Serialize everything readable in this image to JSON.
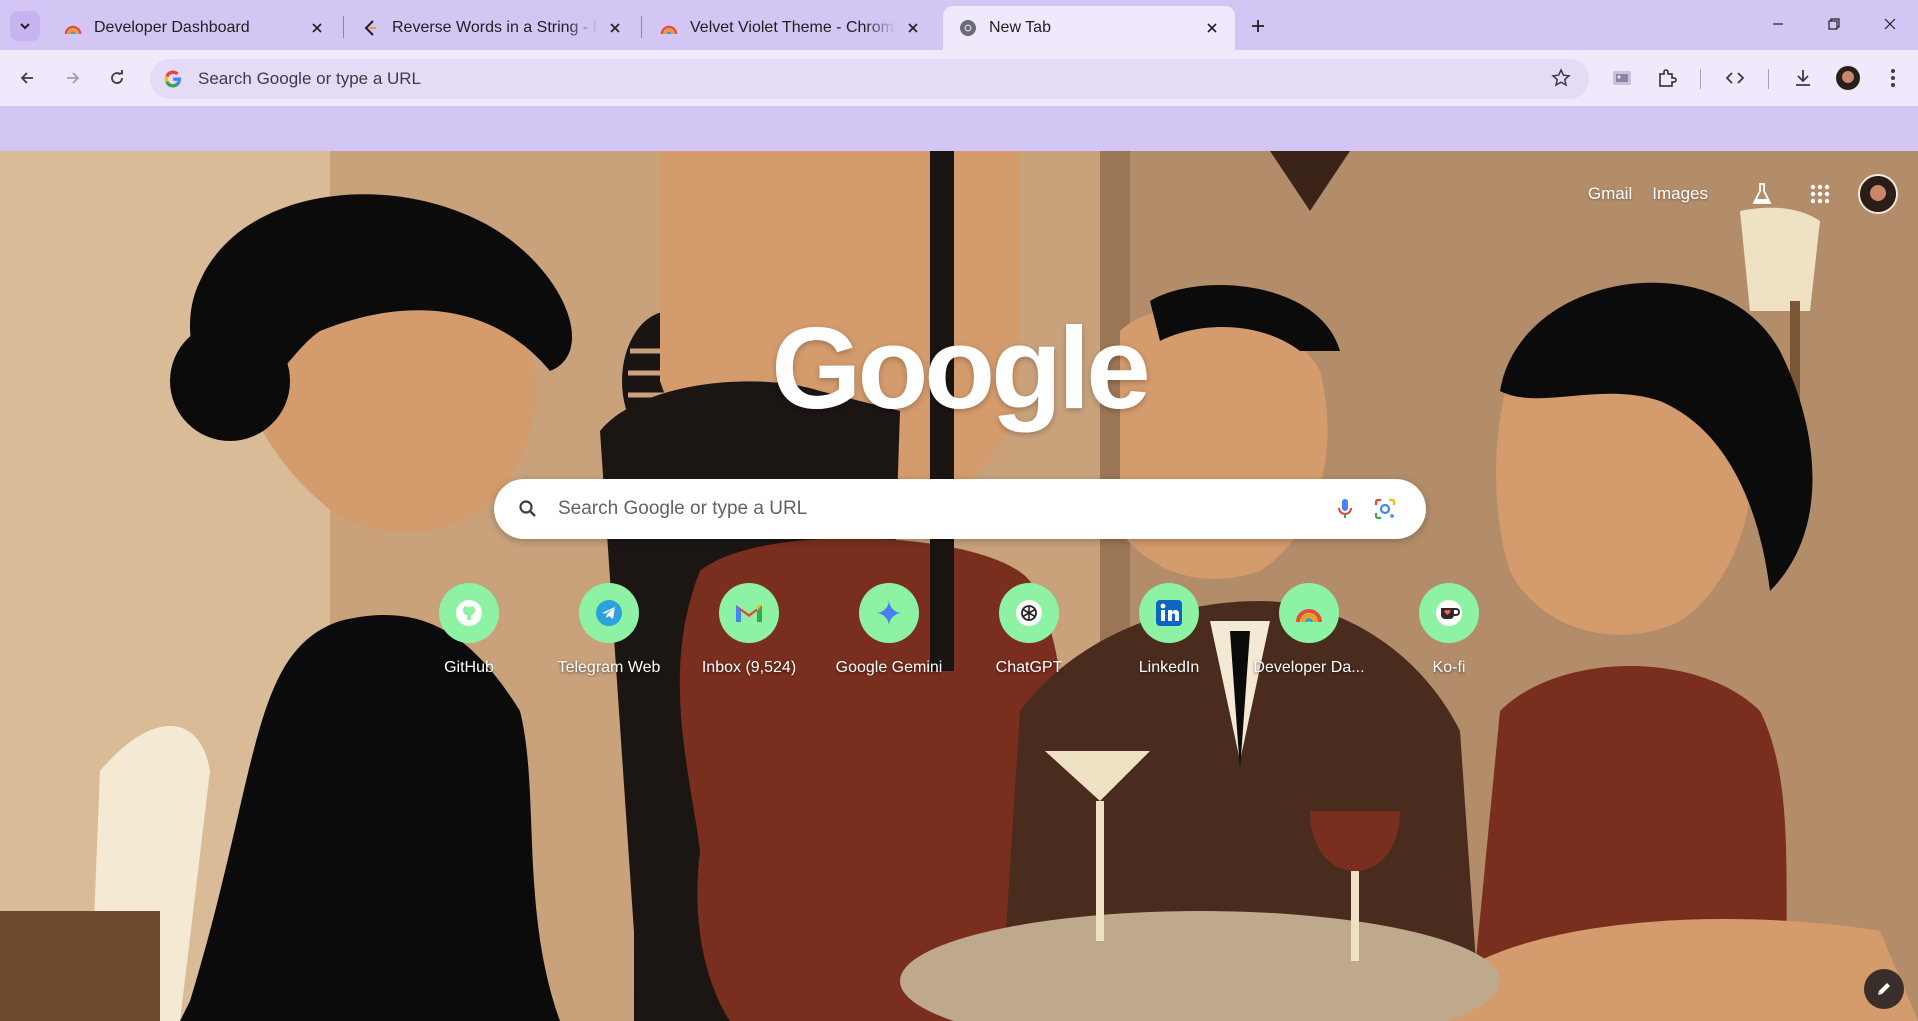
{
  "colors": {
    "frame": "#d3c6f4",
    "toolbar": "#efe9fb",
    "omnibox": "#e4dcf6",
    "shortcut_tile": "#8ef2a4",
    "text_dark": "#1f1f1f"
  },
  "tabs": [
    {
      "title": "Developer Dashboard",
      "icon": "rainbow-icon",
      "active": false
    },
    {
      "title": "Reverse Words in a String - LeetCode",
      "icon": "leetcode-icon",
      "active": false
    },
    {
      "title": "Velvet Violet Theme - Chrome Web Store",
      "icon": "rainbow-icon",
      "active": false
    },
    {
      "title": "New Tab",
      "icon": "chrome-icon",
      "active": true
    }
  ],
  "toolbar": {
    "omnibox_placeholder": "Search Google or type a URL"
  },
  "ntp": {
    "links": {
      "gmail": "Gmail",
      "images": "Images"
    },
    "logo": "Google",
    "search_placeholder": "Search Google or type a URL",
    "shortcuts": [
      {
        "label": "GitHub",
        "icon": "github-icon"
      },
      {
        "label": "Telegram Web",
        "icon": "telegram-icon"
      },
      {
        "label": "Inbox (9,524)",
        "icon": "gmail-icon"
      },
      {
        "label": "Google Gemini",
        "icon": "gemini-icon"
      },
      {
        "label": "ChatGPT",
        "icon": "chatgpt-icon"
      },
      {
        "label": "LinkedIn",
        "icon": "linkedin-icon"
      },
      {
        "label": "Developer Da...",
        "icon": "rainbow-icon"
      },
      {
        "label": "Ko-fi",
        "icon": "kofi-icon"
      }
    ]
  }
}
